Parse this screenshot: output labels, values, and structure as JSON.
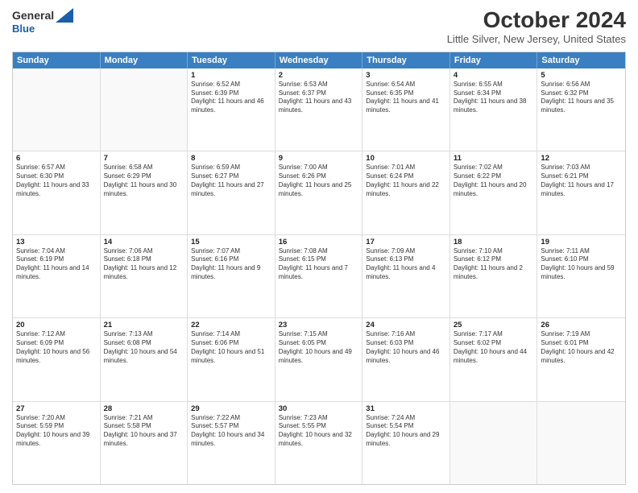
{
  "logo": {
    "line1": "General",
    "line2": "Blue"
  },
  "title": "October 2024",
  "location": "Little Silver, New Jersey, United States",
  "headers": [
    "Sunday",
    "Monday",
    "Tuesday",
    "Wednesday",
    "Thursday",
    "Friday",
    "Saturday"
  ],
  "rows": [
    [
      {
        "day": "",
        "sunrise": "",
        "sunset": "",
        "daylight": "",
        "empty": true
      },
      {
        "day": "",
        "sunrise": "",
        "sunset": "",
        "daylight": "",
        "empty": true
      },
      {
        "day": "1",
        "sunrise": "Sunrise: 6:52 AM",
        "sunset": "Sunset: 6:39 PM",
        "daylight": "Daylight: 11 hours and 46 minutes."
      },
      {
        "day": "2",
        "sunrise": "Sunrise: 6:53 AM",
        "sunset": "Sunset: 6:37 PM",
        "daylight": "Daylight: 11 hours and 43 minutes."
      },
      {
        "day": "3",
        "sunrise": "Sunrise: 6:54 AM",
        "sunset": "Sunset: 6:35 PM",
        "daylight": "Daylight: 11 hours and 41 minutes."
      },
      {
        "day": "4",
        "sunrise": "Sunrise: 6:55 AM",
        "sunset": "Sunset: 6:34 PM",
        "daylight": "Daylight: 11 hours and 38 minutes."
      },
      {
        "day": "5",
        "sunrise": "Sunrise: 6:56 AM",
        "sunset": "Sunset: 6:32 PM",
        "daylight": "Daylight: 11 hours and 35 minutes."
      }
    ],
    [
      {
        "day": "6",
        "sunrise": "Sunrise: 6:57 AM",
        "sunset": "Sunset: 6:30 PM",
        "daylight": "Daylight: 11 hours and 33 minutes."
      },
      {
        "day": "7",
        "sunrise": "Sunrise: 6:58 AM",
        "sunset": "Sunset: 6:29 PM",
        "daylight": "Daylight: 11 hours and 30 minutes."
      },
      {
        "day": "8",
        "sunrise": "Sunrise: 6:59 AM",
        "sunset": "Sunset: 6:27 PM",
        "daylight": "Daylight: 11 hours and 27 minutes."
      },
      {
        "day": "9",
        "sunrise": "Sunrise: 7:00 AM",
        "sunset": "Sunset: 6:26 PM",
        "daylight": "Daylight: 11 hours and 25 minutes."
      },
      {
        "day": "10",
        "sunrise": "Sunrise: 7:01 AM",
        "sunset": "Sunset: 6:24 PM",
        "daylight": "Daylight: 11 hours and 22 minutes."
      },
      {
        "day": "11",
        "sunrise": "Sunrise: 7:02 AM",
        "sunset": "Sunset: 6:22 PM",
        "daylight": "Daylight: 11 hours and 20 minutes."
      },
      {
        "day": "12",
        "sunrise": "Sunrise: 7:03 AM",
        "sunset": "Sunset: 6:21 PM",
        "daylight": "Daylight: 11 hours and 17 minutes."
      }
    ],
    [
      {
        "day": "13",
        "sunrise": "Sunrise: 7:04 AM",
        "sunset": "Sunset: 6:19 PM",
        "daylight": "Daylight: 11 hours and 14 minutes."
      },
      {
        "day": "14",
        "sunrise": "Sunrise: 7:06 AM",
        "sunset": "Sunset: 6:18 PM",
        "daylight": "Daylight: 11 hours and 12 minutes."
      },
      {
        "day": "15",
        "sunrise": "Sunrise: 7:07 AM",
        "sunset": "Sunset: 6:16 PM",
        "daylight": "Daylight: 11 hours and 9 minutes."
      },
      {
        "day": "16",
        "sunrise": "Sunrise: 7:08 AM",
        "sunset": "Sunset: 6:15 PM",
        "daylight": "Daylight: 11 hours and 7 minutes."
      },
      {
        "day": "17",
        "sunrise": "Sunrise: 7:09 AM",
        "sunset": "Sunset: 6:13 PM",
        "daylight": "Daylight: 11 hours and 4 minutes."
      },
      {
        "day": "18",
        "sunrise": "Sunrise: 7:10 AM",
        "sunset": "Sunset: 6:12 PM",
        "daylight": "Daylight: 11 hours and 2 minutes."
      },
      {
        "day": "19",
        "sunrise": "Sunrise: 7:11 AM",
        "sunset": "Sunset: 6:10 PM",
        "daylight": "Daylight: 10 hours and 59 minutes."
      }
    ],
    [
      {
        "day": "20",
        "sunrise": "Sunrise: 7:12 AM",
        "sunset": "Sunset: 6:09 PM",
        "daylight": "Daylight: 10 hours and 56 minutes."
      },
      {
        "day": "21",
        "sunrise": "Sunrise: 7:13 AM",
        "sunset": "Sunset: 6:08 PM",
        "daylight": "Daylight: 10 hours and 54 minutes."
      },
      {
        "day": "22",
        "sunrise": "Sunrise: 7:14 AM",
        "sunset": "Sunset: 6:06 PM",
        "daylight": "Daylight: 10 hours and 51 minutes."
      },
      {
        "day": "23",
        "sunrise": "Sunrise: 7:15 AM",
        "sunset": "Sunset: 6:05 PM",
        "daylight": "Daylight: 10 hours and 49 minutes."
      },
      {
        "day": "24",
        "sunrise": "Sunrise: 7:16 AM",
        "sunset": "Sunset: 6:03 PM",
        "daylight": "Daylight: 10 hours and 46 minutes."
      },
      {
        "day": "25",
        "sunrise": "Sunrise: 7:17 AM",
        "sunset": "Sunset: 6:02 PM",
        "daylight": "Daylight: 10 hours and 44 minutes."
      },
      {
        "day": "26",
        "sunrise": "Sunrise: 7:19 AM",
        "sunset": "Sunset: 6:01 PM",
        "daylight": "Daylight: 10 hours and 42 minutes."
      }
    ],
    [
      {
        "day": "27",
        "sunrise": "Sunrise: 7:20 AM",
        "sunset": "Sunset: 5:59 PM",
        "daylight": "Daylight: 10 hours and 39 minutes."
      },
      {
        "day": "28",
        "sunrise": "Sunrise: 7:21 AM",
        "sunset": "Sunset: 5:58 PM",
        "daylight": "Daylight: 10 hours and 37 minutes."
      },
      {
        "day": "29",
        "sunrise": "Sunrise: 7:22 AM",
        "sunset": "Sunset: 5:57 PM",
        "daylight": "Daylight: 10 hours and 34 minutes."
      },
      {
        "day": "30",
        "sunrise": "Sunrise: 7:23 AM",
        "sunset": "Sunset: 5:55 PM",
        "daylight": "Daylight: 10 hours and 32 minutes."
      },
      {
        "day": "31",
        "sunrise": "Sunrise: 7:24 AM",
        "sunset": "Sunset: 5:54 PM",
        "daylight": "Daylight: 10 hours and 29 minutes."
      },
      {
        "day": "",
        "sunrise": "",
        "sunset": "",
        "daylight": "",
        "empty": true
      },
      {
        "day": "",
        "sunrise": "",
        "sunset": "",
        "daylight": "",
        "empty": true
      }
    ]
  ]
}
